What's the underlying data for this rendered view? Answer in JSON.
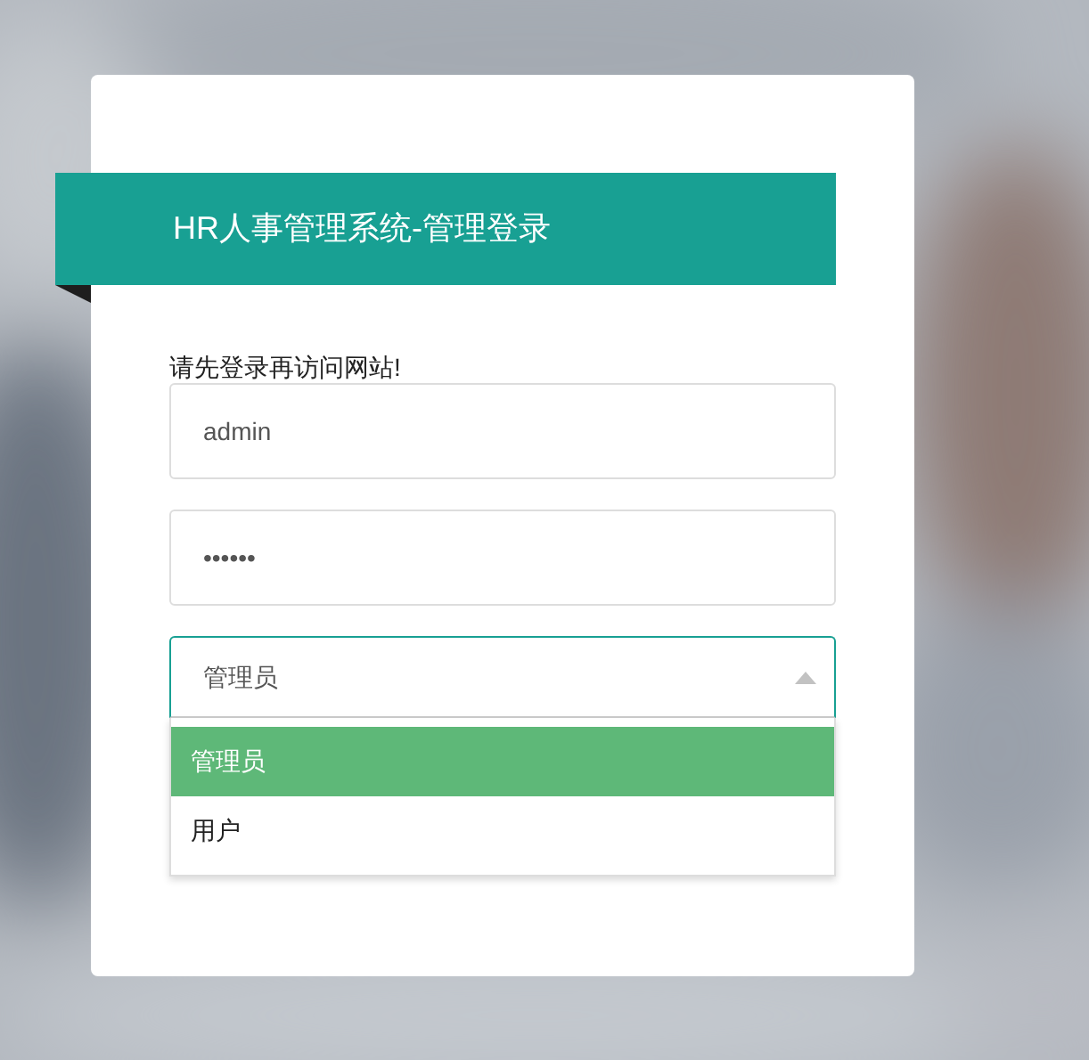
{
  "login": {
    "title": "HR人事管理系统-管理登录",
    "notice": "请先登录再访问网站!",
    "username": {
      "value": "admin"
    },
    "password": {
      "value": "••••••"
    },
    "role_select": {
      "value": "管理员",
      "expanded": true,
      "options": [
        {
          "label": "管理员",
          "selected": true
        },
        {
          "label": "用户",
          "selected": false
        }
      ]
    }
  }
}
